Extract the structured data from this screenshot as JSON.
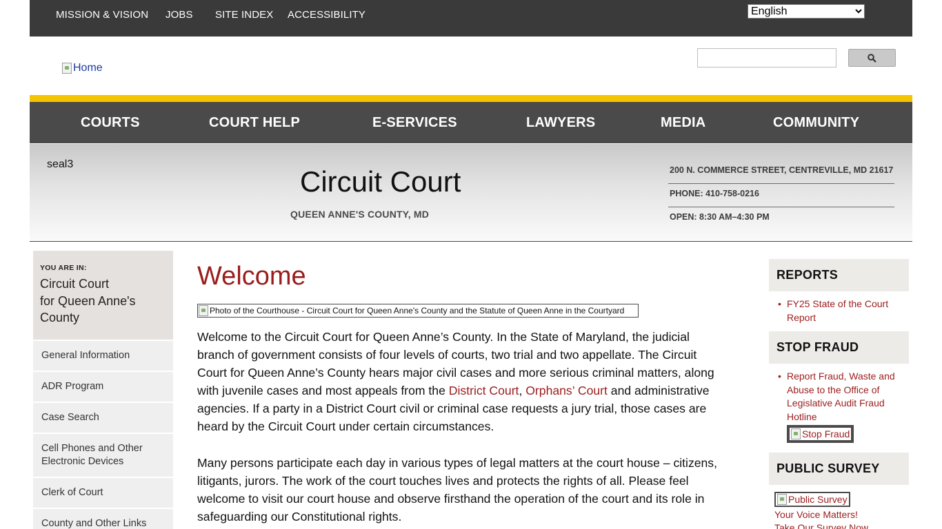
{
  "utility_nav": {
    "items": [
      "MISSION & VISION",
      "JOBS",
      "SITE INDEX",
      "ACCESSIBILITY"
    ],
    "language": "English"
  },
  "header": {
    "logo_alt": "Home",
    "search_placeholder": ""
  },
  "main_nav": [
    "COURTS",
    "COURT HELP",
    "E-SERVICES",
    "LAWYERS",
    "MEDIA",
    "COMMUNITY"
  ],
  "banner": {
    "seal_alt": "seal3",
    "title": "Circuit Court",
    "subtitle": "QUEEN ANNE'S COUNTY, MD",
    "address": "200 N. COMMERCE STREET, CENTREVILLE, MD 21617",
    "phone": "PHONE: 410-758-0216",
    "hours": "OPEN: 8:30 AM–4:30 PM"
  },
  "sidebar": {
    "you_are_in_label": "YOU ARE IN:",
    "crumb": [
      "Circuit Court",
      "for Queen Anne's",
      "County"
    ],
    "items": [
      [
        "General Information"
      ],
      [
        "ADR Program"
      ],
      [
        "Case Search"
      ],
      [
        "Cell Phones and Other",
        "Electronic Devices"
      ],
      [
        "Clerk of Court"
      ],
      [
        "County and Other Links"
      ]
    ]
  },
  "content": {
    "heading": "Welcome",
    "photo_alt": "Photo of the Courthouse - Circuit Court for Queen Anne's County and the Statute of Queen Anne in the Courtyard",
    "p1_before": "Welcome to the Circuit Court for Queen Anne’s County. In the State of Maryland, the judicial branch of government consists of four levels of courts, two trial and two appellate. The Circuit Court for Queen Anne’s County hears major civil cases and more serious criminal matters, along with juvenile cases and most appeals from the ",
    "p1_link1": "District Court",
    "p1_sep": ", ",
    "p1_link2": "Orphans’ Court",
    "p1_after": " and administrative agencies. If a party in a District Court civil or criminal case requests a jury trial, those cases are heard by the Circuit Court under certain circumstances.",
    "p2": "Many persons participate each day in various types of legal matters at the court house – citizens, litigants, jurors. The work of the court touches lives and protects the rights of all. Please feel welcome to visit our court house and observe firsthand the operation of the court and its role in safeguarding our Constitutional rights."
  },
  "right_sidebar": {
    "reports_title": "REPORTS",
    "reports_link": "FY25 State of the Court Report",
    "fraud_title": "STOP FRAUD",
    "fraud_link": "Report Fraud, Waste and Abuse to the Office of Legislative Audit Fraud Hotline",
    "fraud_img_alt": "Stop Fraud",
    "survey_title": "PUBLIC SURVEY",
    "survey_img_alt": "Public Survey",
    "survey_link": "Your Voice Matters!",
    "survey_link2": "Take Our Survey Now"
  }
}
